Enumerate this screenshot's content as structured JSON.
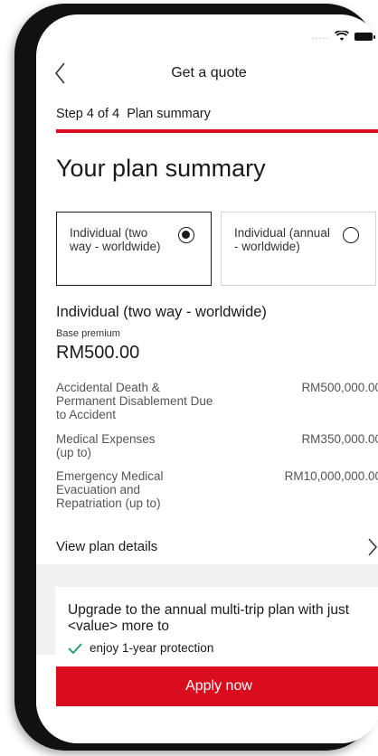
{
  "status_bar": {
    "icons": [
      "signal-dots",
      "wifi-icon",
      "battery-icon"
    ]
  },
  "header": {
    "title": "Get a quote",
    "back_icon": "chevron-left-icon"
  },
  "step": {
    "label": "Step 4 of 4",
    "name": "Plan summary",
    "progress": 1.0
  },
  "page_title": "Your plan summary",
  "plans": [
    {
      "label": "Individual (two way - worldwide)",
      "selected": true
    },
    {
      "label": "Individual (annual - worldwide)",
      "selected": false
    }
  ],
  "selected_plan": {
    "heading": "Individual (two way - worldwide)",
    "base_premium_label": "Base premium",
    "base_premium_value": "RM500.00"
  },
  "benefits": [
    {
      "name": "Accidental Death & Permanent Disablement Due to Accident",
      "amount": "RM500,000.00"
    },
    {
      "name": "Medical Expenses (up to)",
      "amount": "RM350,000.00"
    },
    {
      "name": "Emergency Medical Evacuation and Repatriation (up to)",
      "amount": "RM10,000,000.00"
    }
  ],
  "view_details": {
    "label": "View plan details",
    "icon": "chevron-right-icon"
  },
  "upgrade": {
    "text": "Upgrade to the annual multi-trip plan with just <value> more to",
    "bullets": [
      "enjoy 1-year protection"
    ],
    "check_color": "#1a9b5c"
  },
  "cta": {
    "label": "Apply now",
    "color": "#d90d1e"
  }
}
